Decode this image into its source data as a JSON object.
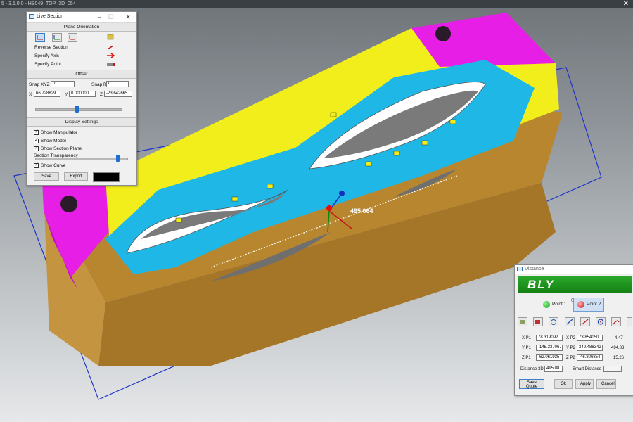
{
  "window": {
    "title": "5 - 3.5.0.0 - HS049_TOP_3D_054"
  },
  "viewport": {
    "measure_label": "495.064"
  },
  "live_section": {
    "title": "Live Section",
    "plane_orientation_header": "Plane Orientation",
    "reverse_section": "Reverse Section",
    "specify_axis": "Specify Axis",
    "specify_point": "Specify Point",
    "offset_header": "Offset",
    "snap_xyz_label": "Snap XYZ",
    "snap_xyz_value": "0",
    "snap_rot_label": "Snap Rot",
    "snap_rot_value": "0",
    "x_label": "X",
    "x_value": "66.728829",
    "y_label": "Y",
    "y_value": "0.000000",
    "z_label": "Z",
    "z_value": "-23.642665",
    "offset_slider": 0.48,
    "display_settings_header": "Display Settings",
    "show_manipulator": "Show Manipulator",
    "show_model": "Show Model",
    "show_section_plane": "Show Section Plane",
    "section_transparency": "Section Transparency",
    "transparency_slider": 0.9,
    "show_curve": "Show Curve",
    "save": "Save",
    "export": "Export",
    "swatch_color": "#000000"
  },
  "distance": {
    "title": "Distance",
    "logo": "BLY",
    "point1": "Point 1",
    "point2": "Point 2",
    "xp1_label": "X P1",
    "xp1": "78.319092",
    "yp1_label": "Y P1",
    "yp1": "-145.337067",
    "zp1_label": "Z P1",
    "zp1": "-62.061935",
    "xp2_label": "X P2",
    "xp2": "73.854050",
    "yp2_label": "Y P2",
    "yp2": "349.488342",
    "zp2_label": "Z P2",
    "zp2": "-46.806854",
    "dx": "-4.47",
    "dy": "494.83",
    "dz": "15.26",
    "distance3d_label": "Distance 3D",
    "distance3d": "495.08",
    "smart_distance_label": "Smart Distance",
    "smart_distance": "",
    "save_quote": "Save Quote",
    "ok": "Ok",
    "apply": "Apply",
    "cancel": "Cancel"
  },
  "colors": {
    "magenta": "#e61ee6",
    "yellow": "#f2ee1c",
    "cyan": "#1fb8e6",
    "bronze": "#b8862e",
    "accent_green": "#1b9a1b"
  }
}
